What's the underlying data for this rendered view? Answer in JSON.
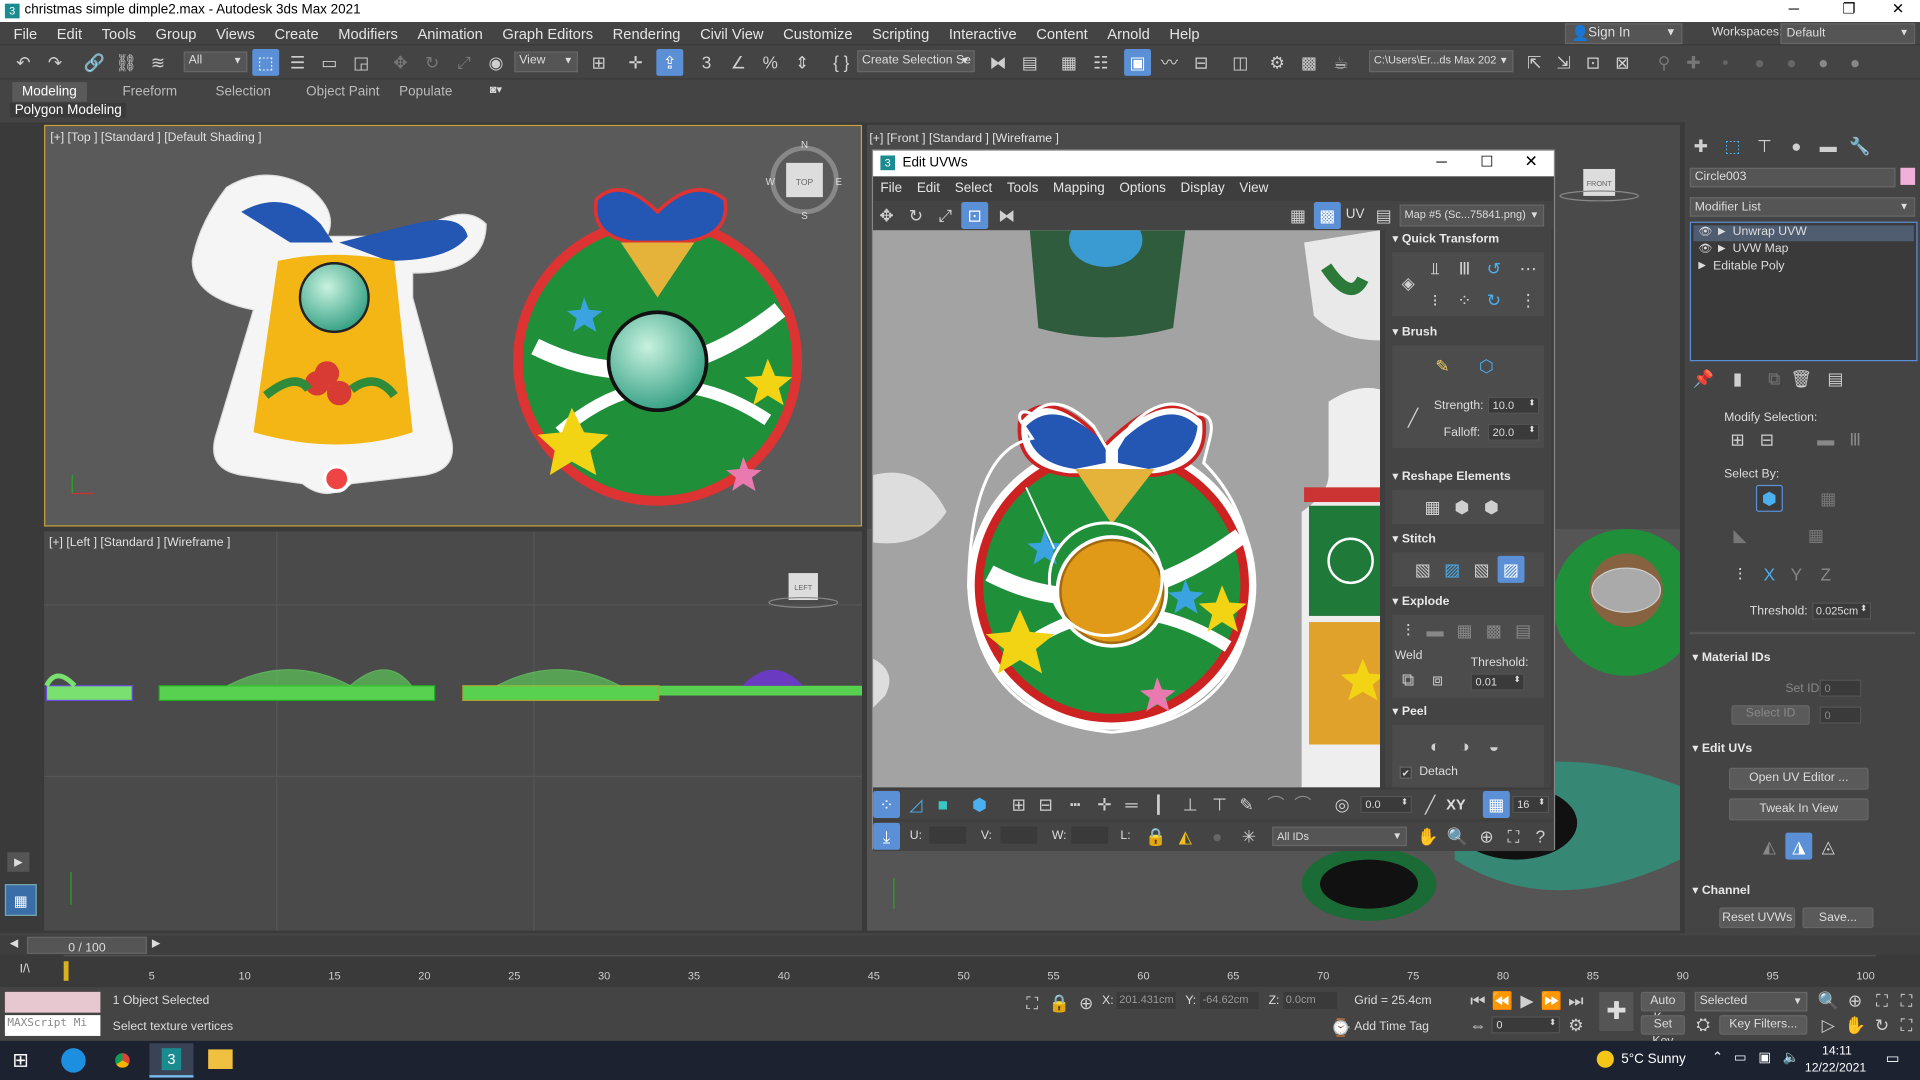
{
  "window": {
    "title": "christmas simple dimple2.max - Autodesk 3ds Max 2021"
  },
  "menu": [
    "File",
    "Edit",
    "Tools",
    "Group",
    "Views",
    "Create",
    "Modifiers",
    "Animation",
    "Graph Editors",
    "Rendering",
    "Civil View",
    "Customize",
    "Scripting",
    "Interactive",
    "Content",
    "Arnold",
    "Help"
  ],
  "account": {
    "sign_in": "Sign In",
    "workspaces_label": "Workspaces:",
    "workspace": "Default"
  },
  "toolbar": {
    "filter": "All",
    "view": "View",
    "selection_set": "Create Selection Se",
    "path": "C:\\Users\\Er...ds Max 202"
  },
  "ribbon": {
    "tabs": [
      "Modeling",
      "Freeform",
      "Selection",
      "Object Paint",
      "Populate"
    ],
    "sub": "Polygon Modeling"
  },
  "viewports": {
    "top": "[+] [Top ] [Standard ] [Default Shading ]",
    "front": "[+] [Front ] [Standard ] [Wireframe ]",
    "left": "[+] [Left ] [Standard ] [Wireframe ]",
    "cube_top": "TOP",
    "cube_front": "FRONT",
    "cube_left": "LEFT",
    "compass": [
      "N",
      "E",
      "S",
      "W"
    ]
  },
  "uv_editor": {
    "title": "Edit UVWs",
    "menu": [
      "File",
      "Edit",
      "Select",
      "Tools",
      "Mapping",
      "Options",
      "Display",
      "View"
    ],
    "uv_label": "UV",
    "map": "Map #5 (Sc...75841.png)",
    "sections": {
      "quick_transform": "Quick Transform",
      "brush": "Brush",
      "strength_label": "Strength:",
      "strength": "10.0",
      "falloff_label": "Falloff:",
      "falloff": "20.0",
      "reshape": "Reshape Elements",
      "stitch": "Stitch",
      "explode": "Explode",
      "weld": "Weld",
      "threshold_label": "Threshold:",
      "threshold": "0.01",
      "peel": "Peel",
      "detach": "Detach"
    },
    "bottom": {
      "rot": "0.0",
      "xy": "XY",
      "grid": "16",
      "u": "U:",
      "v": "V:",
      "w": "W:",
      "l": "L:",
      "ids": "All IDs"
    }
  },
  "command_panel": {
    "object_name": "Circle003",
    "modifier_list": "Modifier List",
    "stack": [
      "Unwrap UVW",
      "UVW Map",
      "Editable Poly"
    ],
    "modify_selection": "Modify Selection:",
    "select_by": "Select By:",
    "threshold_label": "Threshold:",
    "threshold": "0.025cm",
    "material_ids": "Material IDs",
    "set_id": "Set ID:",
    "set_id_val": "0",
    "select_id": "Select ID",
    "select_id_val": "0",
    "edit_uvs": "Edit UVs",
    "open_uv_editor": "Open UV Editor ...",
    "tweak_in_view": "Tweak In View",
    "channel": "Channel",
    "reset_uvws": "Reset UVWs",
    "save": "Save..."
  },
  "timeline": {
    "frame": "0 / 100",
    "ticks": [
      "5",
      "10",
      "15",
      "20",
      "25",
      "30",
      "35",
      "40",
      "45",
      "50",
      "55",
      "60",
      "65",
      "70",
      "75",
      "80",
      "85",
      "90",
      "95",
      "100"
    ]
  },
  "status": {
    "maxscript": "MAXScript Mi",
    "selected": "1 Object Selected",
    "prompt": "Select texture vertices",
    "x_label": "X:",
    "x": "201.431cm",
    "y_label": "Y:",
    "y": "-64.62cm",
    "z_label": "Z:",
    "z": "0.0cm",
    "grid": "Grid = 25.4cm",
    "add_time_tag": "Add Time Tag",
    "auto_key": "Auto K...",
    "set_key": "Set Key",
    "key_mode": "Selected",
    "key_filters": "Key Filters...",
    "frame_spinner": "0"
  },
  "taskbar": {
    "weather": "5°C  Sunny",
    "time": "14:11",
    "date": "12/22/2021"
  },
  "colors": {
    "accent": "#5b8fd6",
    "uv_bg": "#9d9d9d",
    "viewport_bg": "#4a4a4a",
    "ui_bg": "#444444"
  }
}
